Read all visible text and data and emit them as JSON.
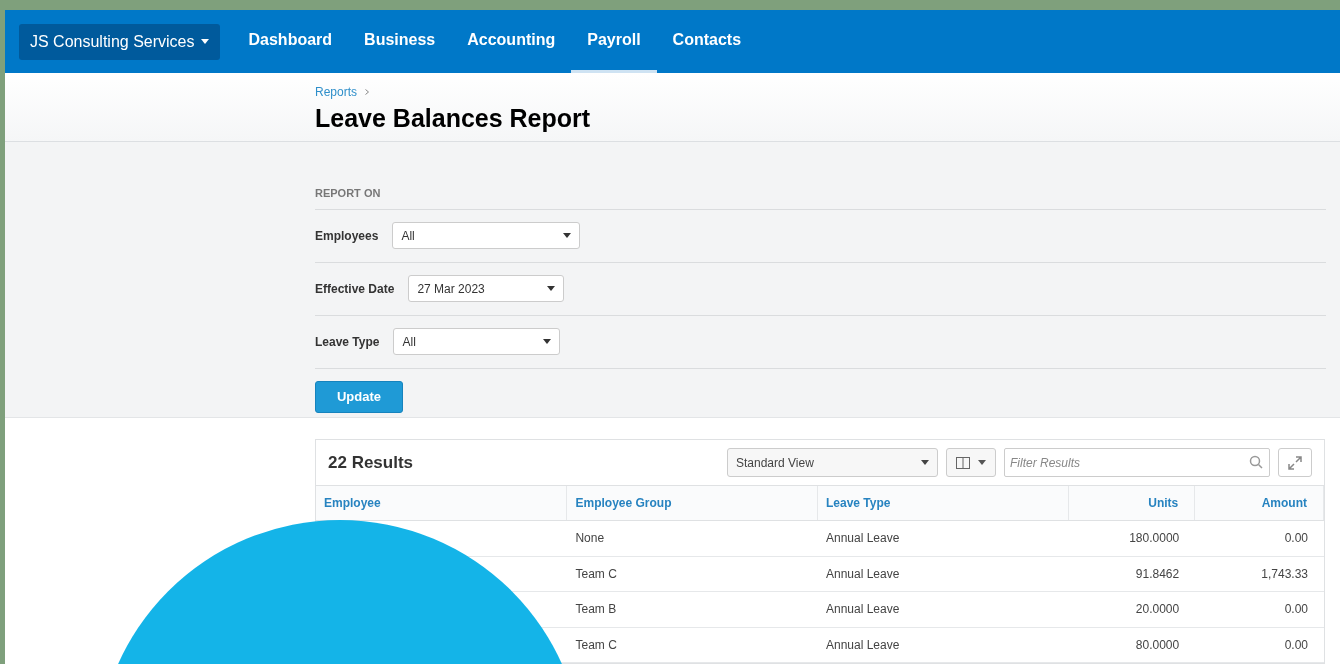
{
  "nav": {
    "org": "JS Consulting Services",
    "items": [
      {
        "label": "Dashboard",
        "selected": false
      },
      {
        "label": "Business",
        "selected": false
      },
      {
        "label": "Accounting",
        "selected": false
      },
      {
        "label": "Payroll",
        "selected": true
      },
      {
        "label": "Contacts",
        "selected": false
      }
    ]
  },
  "breadcrumb": "Reports",
  "title": "Leave Balances Report",
  "report_on": {
    "heading": "REPORT ON",
    "filters": [
      {
        "label": "Employees",
        "value": "All"
      },
      {
        "label": "Effective Date",
        "value": "27 Mar 2023"
      },
      {
        "label": "Leave Type",
        "value": "All"
      }
    ],
    "button": "Update"
  },
  "results": {
    "count": "22 Results",
    "view": "Standard View",
    "filter_placeholder": "Filter Results",
    "columns": [
      "Employee",
      "Employee Group",
      "Leave Type",
      "Units",
      "Amount"
    ],
    "rows": [
      [
        "",
        "None",
        "Annual Leave",
        "180.0000",
        "0.00"
      ],
      [
        "",
        "Team C",
        "Annual Leave",
        "91.8462",
        "1,743.33"
      ],
      [
        "",
        "Team B",
        "Annual Leave",
        "20.0000",
        "0.00"
      ],
      [
        "",
        "Team C",
        "Annual Leave",
        "80.0000",
        "0.00"
      ]
    ]
  }
}
